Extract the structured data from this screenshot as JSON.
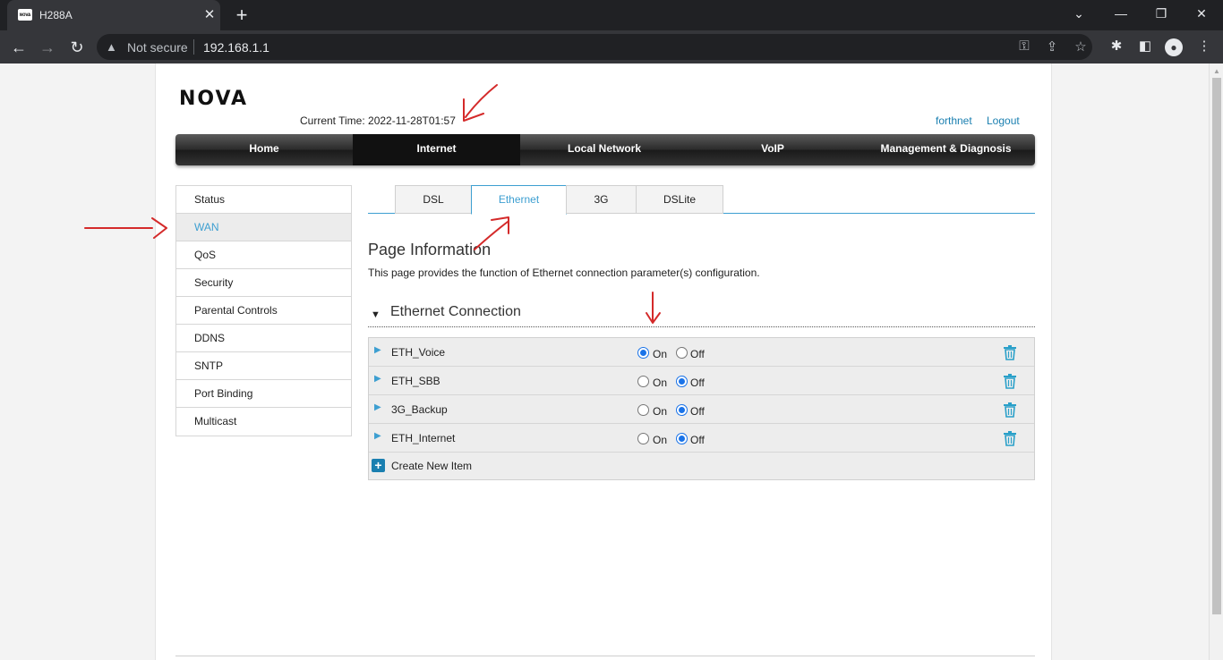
{
  "browser": {
    "tab_title": "H288A",
    "favicon_text": "NOVA",
    "security_label": "Not secure",
    "url": "192.168.1.1"
  },
  "header": {
    "logo": "NOVA",
    "current_time": "Current Time: 2022-11-28T01:57",
    "user": "forthnet",
    "logout": "Logout"
  },
  "mainnav": {
    "items": [
      {
        "label": "Home",
        "active": false
      },
      {
        "label": "Internet",
        "active": true
      },
      {
        "label": "Local Network",
        "active": false
      },
      {
        "label": "VoIP",
        "active": false
      },
      {
        "label": "Management & Diagnosis",
        "active": false
      }
    ]
  },
  "sidemenu": {
    "items": [
      {
        "label": "Status",
        "active": false
      },
      {
        "label": "WAN",
        "active": true
      },
      {
        "label": "QoS",
        "active": false
      },
      {
        "label": "Security",
        "active": false
      },
      {
        "label": "Parental Controls",
        "active": false
      },
      {
        "label": "DDNS",
        "active": false
      },
      {
        "label": "SNTP",
        "active": false
      },
      {
        "label": "Port Binding",
        "active": false
      },
      {
        "label": "Multicast",
        "active": false
      }
    ]
  },
  "subtabs": {
    "items": [
      {
        "label": "DSL",
        "active": false
      },
      {
        "label": "Ethernet",
        "active": true
      },
      {
        "label": "3G",
        "active": false
      },
      {
        "label": "DSLite",
        "active": false
      }
    ]
  },
  "page_info": {
    "title": "Page Information",
    "description": "This page provides the function of Ethernet connection parameter(s) configuration."
  },
  "section": {
    "title": "Ethernet Connection",
    "on_label": "On",
    "off_label": "Off",
    "rows": [
      {
        "name": "ETH_Voice",
        "state": "On"
      },
      {
        "name": "ETH_SBB",
        "state": "Off"
      },
      {
        "name": "3G_Backup",
        "state": "Off"
      },
      {
        "name": "ETH_Internet",
        "state": "Off"
      }
    ],
    "create_label": "Create New Item"
  },
  "colors": {
    "accent": "#3d9fd1",
    "link": "#1a7fb0",
    "annotation": "#d42a2a"
  }
}
